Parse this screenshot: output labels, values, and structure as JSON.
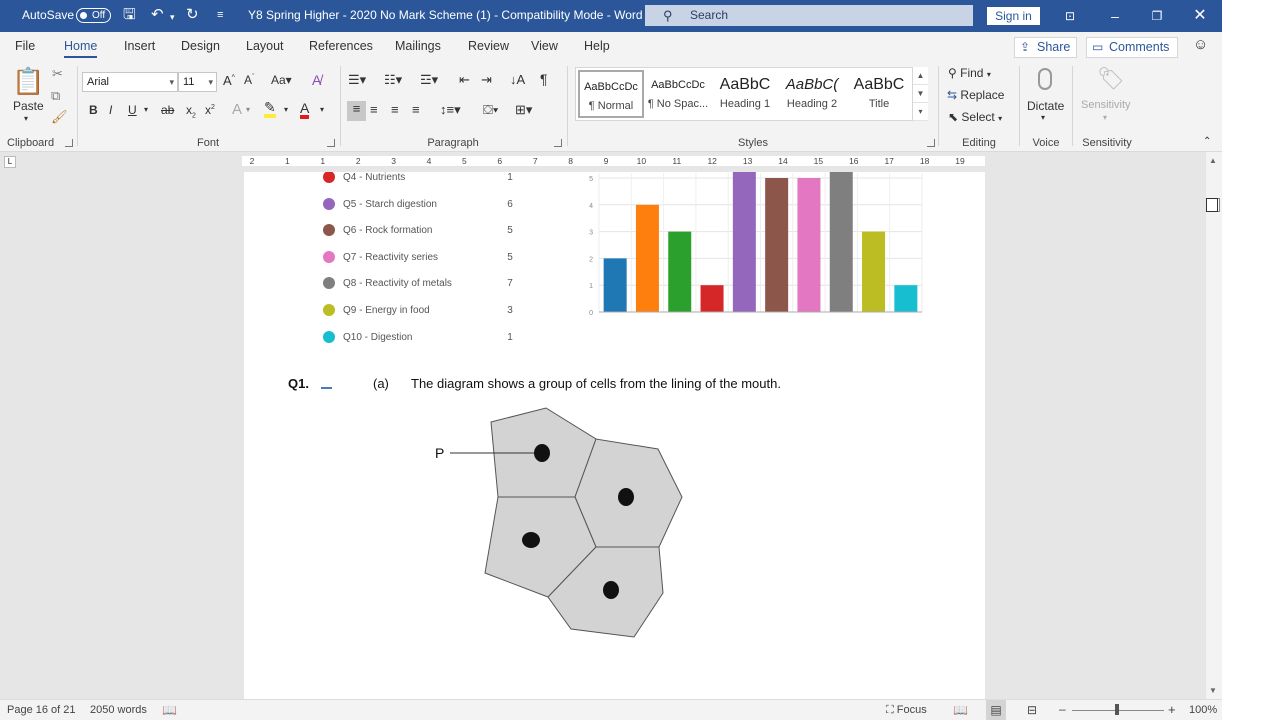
{
  "titlebar": {
    "autosave_label": "AutoSave",
    "autosave_state": "Off",
    "doc_title": "Y8 Spring Higher - 2020 No Mark Scheme (1)  -  Compatibility Mode  -  Word",
    "search_placeholder": "Search",
    "signin_label": "Sign in"
  },
  "tabs": [
    "File",
    "Home",
    "Insert",
    "Design",
    "Layout",
    "References",
    "Mailings",
    "Review",
    "View",
    "Help"
  ],
  "tab_buttons": {
    "share": "Share",
    "comments": "Comments"
  },
  "ribbon": {
    "clipboard": {
      "paste": "Paste",
      "label": "Clipboard"
    },
    "font": {
      "name": "Arial",
      "size": "11",
      "label": "Font"
    },
    "paragraph": {
      "label": "Paragraph"
    },
    "styles": {
      "label": "Styles",
      "items": [
        {
          "preview": "AaBbCcDc",
          "name": "¶ Normal"
        },
        {
          "preview": "AaBbCcDc",
          "name": "¶ No Spac..."
        },
        {
          "preview": "AaBbC",
          "name": "Heading 1"
        },
        {
          "preview": "AaBbC(",
          "name": "Heading 2"
        },
        {
          "preview": "AaBbC",
          "name": "Title"
        }
      ]
    },
    "editing": {
      "find": "Find",
      "replace": "Replace",
      "select": "Select",
      "label": "Editing"
    },
    "voice": {
      "dictate": "Dictate",
      "label": "Voice"
    },
    "sensitivity": {
      "button": "Sensitivity",
      "label": "Sensitivity"
    }
  },
  "ruler": [
    "2",
    "1",
    "1",
    "2",
    "3",
    "4",
    "5",
    "6",
    "7",
    "8",
    "9",
    "10",
    "11",
    "12",
    "13",
    "14",
    "15",
    "16",
    "17",
    "18",
    "19"
  ],
  "document": {
    "legend": [
      {
        "label": "Q4 - Nutrients",
        "value": "1",
        "color": "#d62728"
      },
      {
        "label": "Q5 - Starch digestion",
        "value": "6",
        "color": "#9467bd"
      },
      {
        "label": "Q6 - Rock formation",
        "value": "5",
        "color": "#8c564b"
      },
      {
        "label": "Q7 - Reactivity series",
        "value": "5",
        "color": "#e377c2"
      },
      {
        "label": "Q8 - Reactivity of metals",
        "value": "7",
        "color": "#7f7f7f"
      },
      {
        "label": "Q9 - Energy in food",
        "value": "3",
        "color": "#bcbd22"
      },
      {
        "label": "Q10 - Digestion",
        "value": "1",
        "color": "#17becf"
      }
    ],
    "question": {
      "number": "Q1.",
      "part": "(a)",
      "text": "The diagram shows a group of cells from the lining of the mouth.",
      "diagram_label": "P"
    }
  },
  "chart_data": {
    "type": "bar",
    "categories": [
      "",
      "",
      "",
      "",
      "",
      "",
      "",
      "",
      "",
      ""
    ],
    "values": [
      2,
      4,
      3,
      1,
      6,
      5,
      5,
      7,
      3,
      1
    ],
    "colors": [
      "#1f77b4",
      "#ff7f0e",
      "#2ca02c",
      "#d62728",
      "#9467bd",
      "#8c564b",
      "#e377c2",
      "#7f7f7f",
      "#bcbd22",
      "#17becf"
    ],
    "yticks": [
      "0",
      "1",
      "2",
      "3",
      "4",
      "5"
    ],
    "ylim": [
      0,
      5
    ],
    "grid": true,
    "title": "",
    "xlabel": "",
    "ylabel": ""
  },
  "status": {
    "page": "Page 16 of 21",
    "words": "2050 words",
    "focus": "Focus",
    "zoom": "100%"
  }
}
